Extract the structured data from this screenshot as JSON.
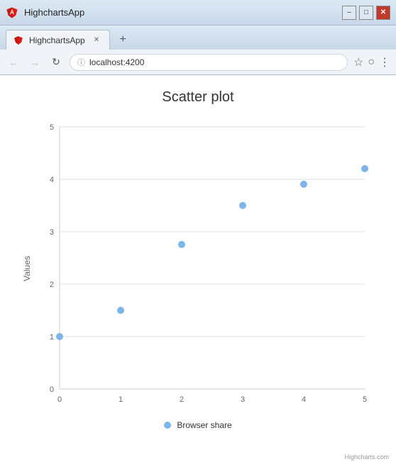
{
  "window": {
    "title": "HighchartsApp",
    "url": "localhost:4200"
  },
  "controls": {
    "minimize": "–",
    "maximize": "□",
    "close": "✕",
    "new_tab": "+"
  },
  "nav": {
    "back": "←",
    "forward": "→",
    "refresh": "↻",
    "bookmark": "☆",
    "profile": "○",
    "menu": "⋮"
  },
  "chart": {
    "title": "Scatter plot",
    "y_axis_label": "Values",
    "legend_label": "Browser share",
    "credit": "Highcharts.com",
    "x_ticks": [
      "0",
      "1",
      "2",
      "3",
      "4",
      "5"
    ],
    "y_ticks": [
      "0",
      "1",
      "2",
      "3",
      "4",
      "5"
    ],
    "data_points": [
      {
        "x": 0,
        "y": 1.0
      },
      {
        "x": 1,
        "y": 1.5
      },
      {
        "x": 2,
        "y": 2.75
      },
      {
        "x": 3,
        "y": 3.5
      },
      {
        "x": 4,
        "y": 3.9
      },
      {
        "x": 5,
        "y": 4.2
      }
    ],
    "accent_color": "#7cb5ec"
  }
}
